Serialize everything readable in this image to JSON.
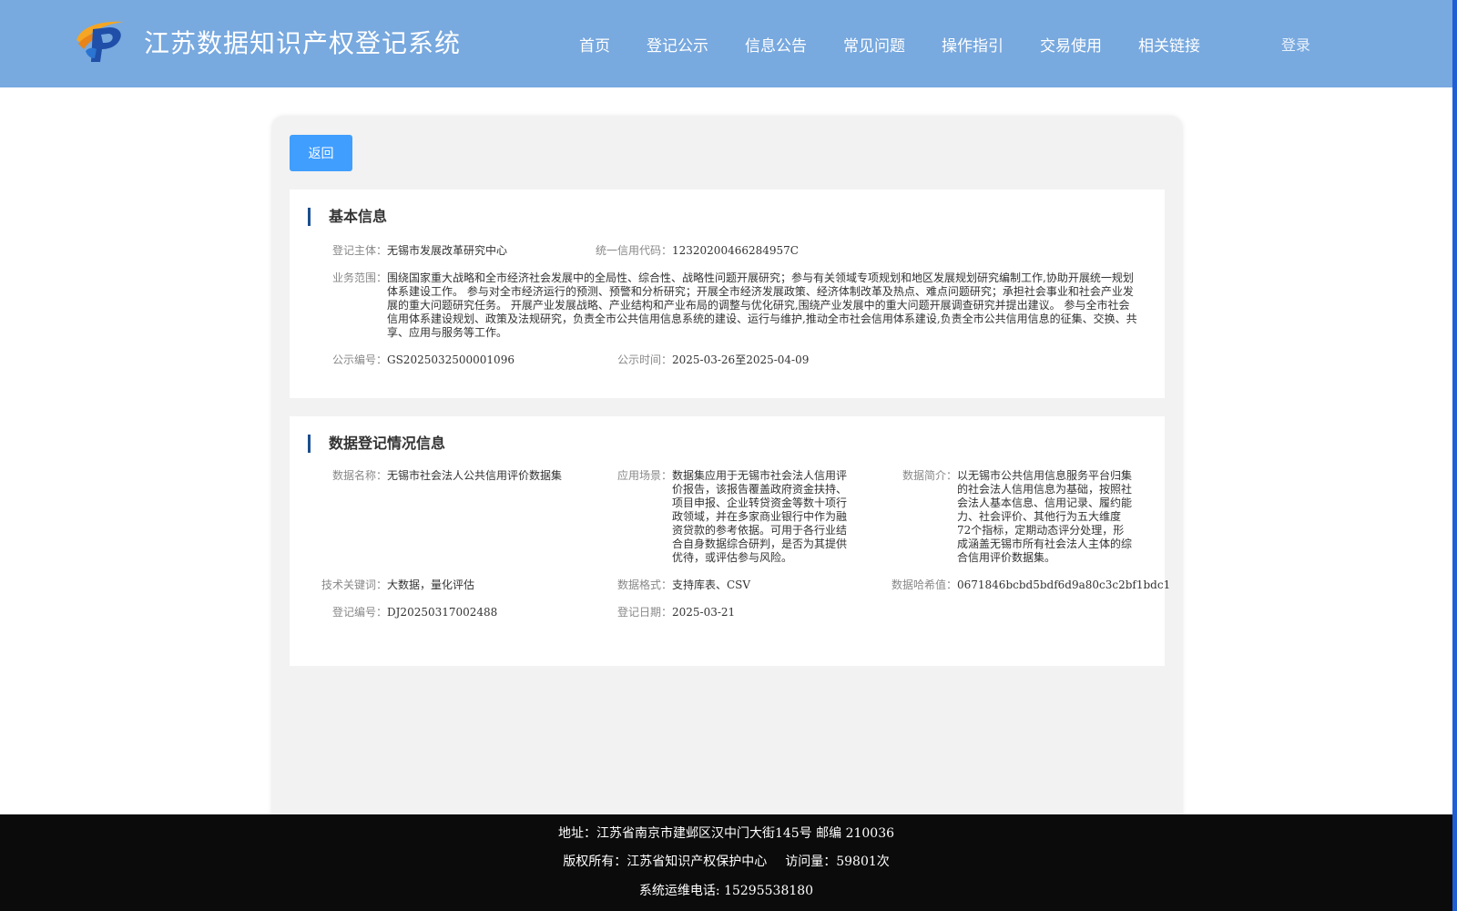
{
  "header": {
    "title": "江苏数据知识产权登记系统",
    "logo_icon": "ip-logo-icon",
    "nav": [
      "首页",
      "登记公示",
      "信息公告",
      "常见问题",
      "操作指引",
      "交易使用",
      "相关链接"
    ],
    "login": "登录"
  },
  "colors": {
    "header_bg": "#78a9df",
    "button_bg": "#409eff",
    "title_bar": "#1b4f8f",
    "footer_bg": "#0b0b0b"
  },
  "panel": {
    "back_label": "返回",
    "basic": {
      "title": "基本信息",
      "subject_label": "登记主体：",
      "subject": "无锡市发展改革研究中心",
      "credit_label": "统一信用代码：",
      "credit": "12320200466284957C",
      "scope_label": "业务范围：",
      "scope": "围绕国家重大战略和全市经济社会发展中的全局性、综合性、战略性问题开展研究；参与有关领域专项规划和地区发展规划研究编制工作,协助开展统一规划体系建设工作。 参与对全市经济运行的预测、预警和分析研究；开展全市经济发展政策、经济体制改革及热点、难点问题研究；承担社会事业和社会产业发展的重大问题研究任务。 开展产业发展战略、产业结构和产业布局的调整与优化研究,围绕产业发展中的重大问题开展调查研究并提出建议。 参与全市社会信用体系建设规划、政策及法规研究，负责全市公共信用信息系统的建设、运行与维护,推动全市社会信用体系建设,负责全市公共信用信息的征集、交换、共享、应用与服务等工作。",
      "pub_no_label": "公示编号：",
      "pub_no": "GS2025032500001096",
      "pub_time_label": "公示时间：",
      "pub_time": "2025-03-26至2025-04-09"
    },
    "data": {
      "title": "数据登记情况信息",
      "name_label": "数据名称：",
      "name": "无锡市社会法人公共信用评价数据集",
      "scene_label": "应用场景：",
      "scene": "数据集应用于无锡市社会法人信用评价报告，该报告覆盖政府资金扶持、项目申报、企业转贷资金等数十项行政领域，并在多家商业银行中作为融资贷款的参考依据。可用于各行业结合自身数据综合研判，是否为其提供优待，或评估参与风险。",
      "intro_label": "数据简介：",
      "intro": "以无锡市公共信用信息服务平台归集的社会法人信用信息为基础，按照社会法人基本信息、信用记录、履约能力、社会评价、其他行为五大维度72个指标，定期动态评分处理，形成涵盖无锡市所有社会法人主体的综合信用评价数据集。",
      "keywords_label": "技术关键词：",
      "keywords": "大数据，量化评估",
      "format_label": "数据格式：",
      "format": "支持库表、CSV",
      "hash_label": "数据哈希值：",
      "hash": "0671846bcbd5bdf6d9a80c3c2bf1bdc1",
      "reg_no_label": "登记编号：",
      "reg_no": "DJ20250317002488",
      "reg_date_label": "登记日期：",
      "reg_date": "2025-03-21"
    }
  },
  "footer": {
    "address": "地址：江苏省南京市建邺区汉中门大街145号 邮编 210036",
    "copyright": "版权所有：江苏省知识产权保护中心",
    "visits": "访问量：59801次",
    "phone": "系统运维电话: 15295538180"
  }
}
